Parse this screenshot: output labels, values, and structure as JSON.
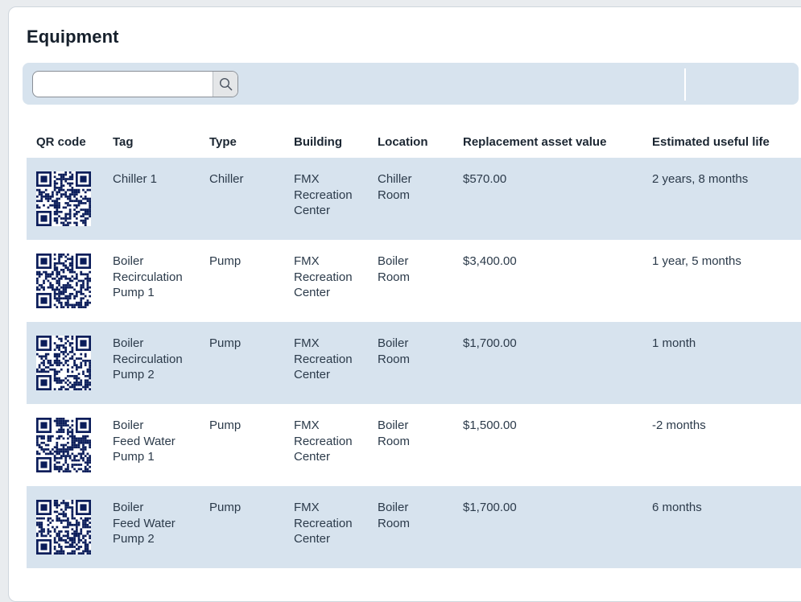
{
  "page": {
    "title": "Equipment"
  },
  "search": {
    "placeholder": "",
    "value": "",
    "icon": "search-icon"
  },
  "table": {
    "columns": [
      "QR code",
      "Tag",
      "Type",
      "Building",
      "Location",
      "Replacement asset value",
      "Estimated useful life"
    ],
    "rows": [
      {
        "tag_lines": [
          "Chiller 1"
        ],
        "type": "Chiller",
        "building_lines": [
          "FMX",
          "Recreation",
          "Center"
        ],
        "location_lines": [
          "Chiller",
          "Room"
        ],
        "value": "$570.00",
        "life": "2 years, 8 months"
      },
      {
        "tag_lines": [
          "Boiler",
          "Recirculation",
          "Pump 1"
        ],
        "type": "Pump",
        "building_lines": [
          "FMX",
          "Recreation",
          "Center"
        ],
        "location_lines": [
          "Boiler",
          "Room"
        ],
        "value": "$3,400.00",
        "life": "1 year, 5 months"
      },
      {
        "tag_lines": [
          "Boiler",
          "Recirculation",
          "Pump 2"
        ],
        "type": "Pump",
        "building_lines": [
          "FMX",
          "Recreation",
          "Center"
        ],
        "location_lines": [
          "Boiler",
          "Room"
        ],
        "value": "$1,700.00",
        "life": "1 month"
      },
      {
        "tag_lines": [
          "Boiler",
          "Feed Water",
          "Pump 1"
        ],
        "type": "Pump",
        "building_lines": [
          "FMX",
          "Recreation",
          "Center"
        ],
        "location_lines": [
          "Boiler",
          "Room"
        ],
        "value": "$1,500.00",
        "life": "-2 months"
      },
      {
        "tag_lines": [
          "Boiler",
          "Feed Water",
          "Pump 2"
        ],
        "type": "Pump",
        "building_lines": [
          "FMX",
          "Recreation",
          "Center"
        ],
        "location_lines": [
          "Boiler",
          "Room"
        ],
        "value": "$1,700.00",
        "life": "6 months"
      }
    ]
  },
  "colors": {
    "row_shaded": "#d7e3ee",
    "qr_ink": "#0b1d5a"
  }
}
